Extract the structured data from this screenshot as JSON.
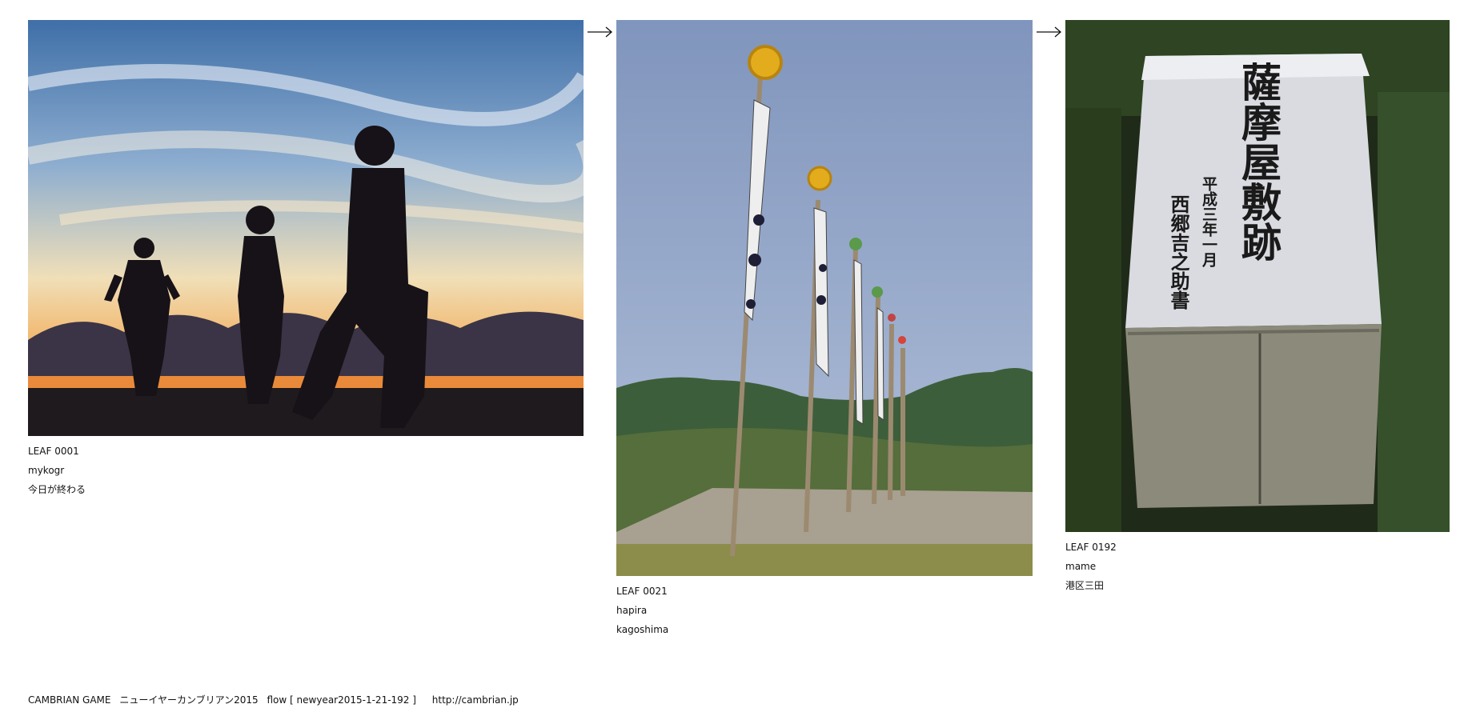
{
  "leaves": [
    {
      "id": "LEAF 0001",
      "author": "mykogr",
      "title": "今日が終わる"
    },
    {
      "id": "LEAF 0021",
      "author": "hapira",
      "title": "kagoshima"
    },
    {
      "id": "LEAF 0192",
      "author": "mame",
      "title": "港区三田"
    }
  ],
  "stone_inscription": {
    "main": "薩摩屋敷跡",
    "date": "平成三年一月",
    "author": "西郷吉之助書"
  },
  "footer": {
    "brand": "CAMBRIAN GAME",
    "event": "ニューイヤーカンブリアン2015",
    "flow": "flow [ newyear2015-1-21-192 ]",
    "url": "http://cambrian.jp"
  },
  "icons": [
    "right-arrow-icon"
  ],
  "colors": {
    "text": "#111111",
    "background": "#ffffff"
  }
}
